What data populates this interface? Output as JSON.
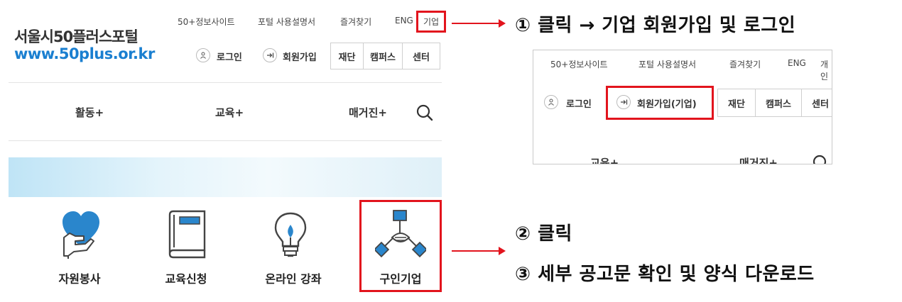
{
  "site": {
    "logo_title": "서울시50플러스포털",
    "logo_url": "www.50plus.or.kr",
    "top_links": [
      "50+정보사이트",
      "포털 사용설명서",
      "즐겨찾기",
      "ENG",
      "기업"
    ],
    "login_label": "로그인",
    "signup_label": "회원가입",
    "segments": [
      "재단",
      "캠퍼스",
      "센터"
    ],
    "main_nav": [
      "활동+",
      "교육+",
      "매거진+"
    ],
    "tiles": [
      "자원봉사",
      "교육신청",
      "온라인 강좌",
      "구인기업"
    ]
  },
  "inset": {
    "top_links": [
      "50+정보사이트",
      "포털 사용설명서",
      "즐겨찾기",
      "ENG",
      "개인"
    ],
    "login_label": "로그인",
    "signup_label": "회원가입(기업)",
    "segments": [
      "재단",
      "캠퍼스",
      "센터"
    ],
    "main_nav": [
      "교육+",
      "매거진+"
    ]
  },
  "annotations": {
    "step1": "① 클릭 → 기업 회원가입 및 로그인",
    "step2": "② 클릭",
    "step3": "③ 세부 공고문 확인 및 양식 다운로드"
  },
  "colors": {
    "highlight": "#e2141d",
    "brand_blue": "#1a7fd0",
    "icon_blue": "#1a7fd0"
  }
}
